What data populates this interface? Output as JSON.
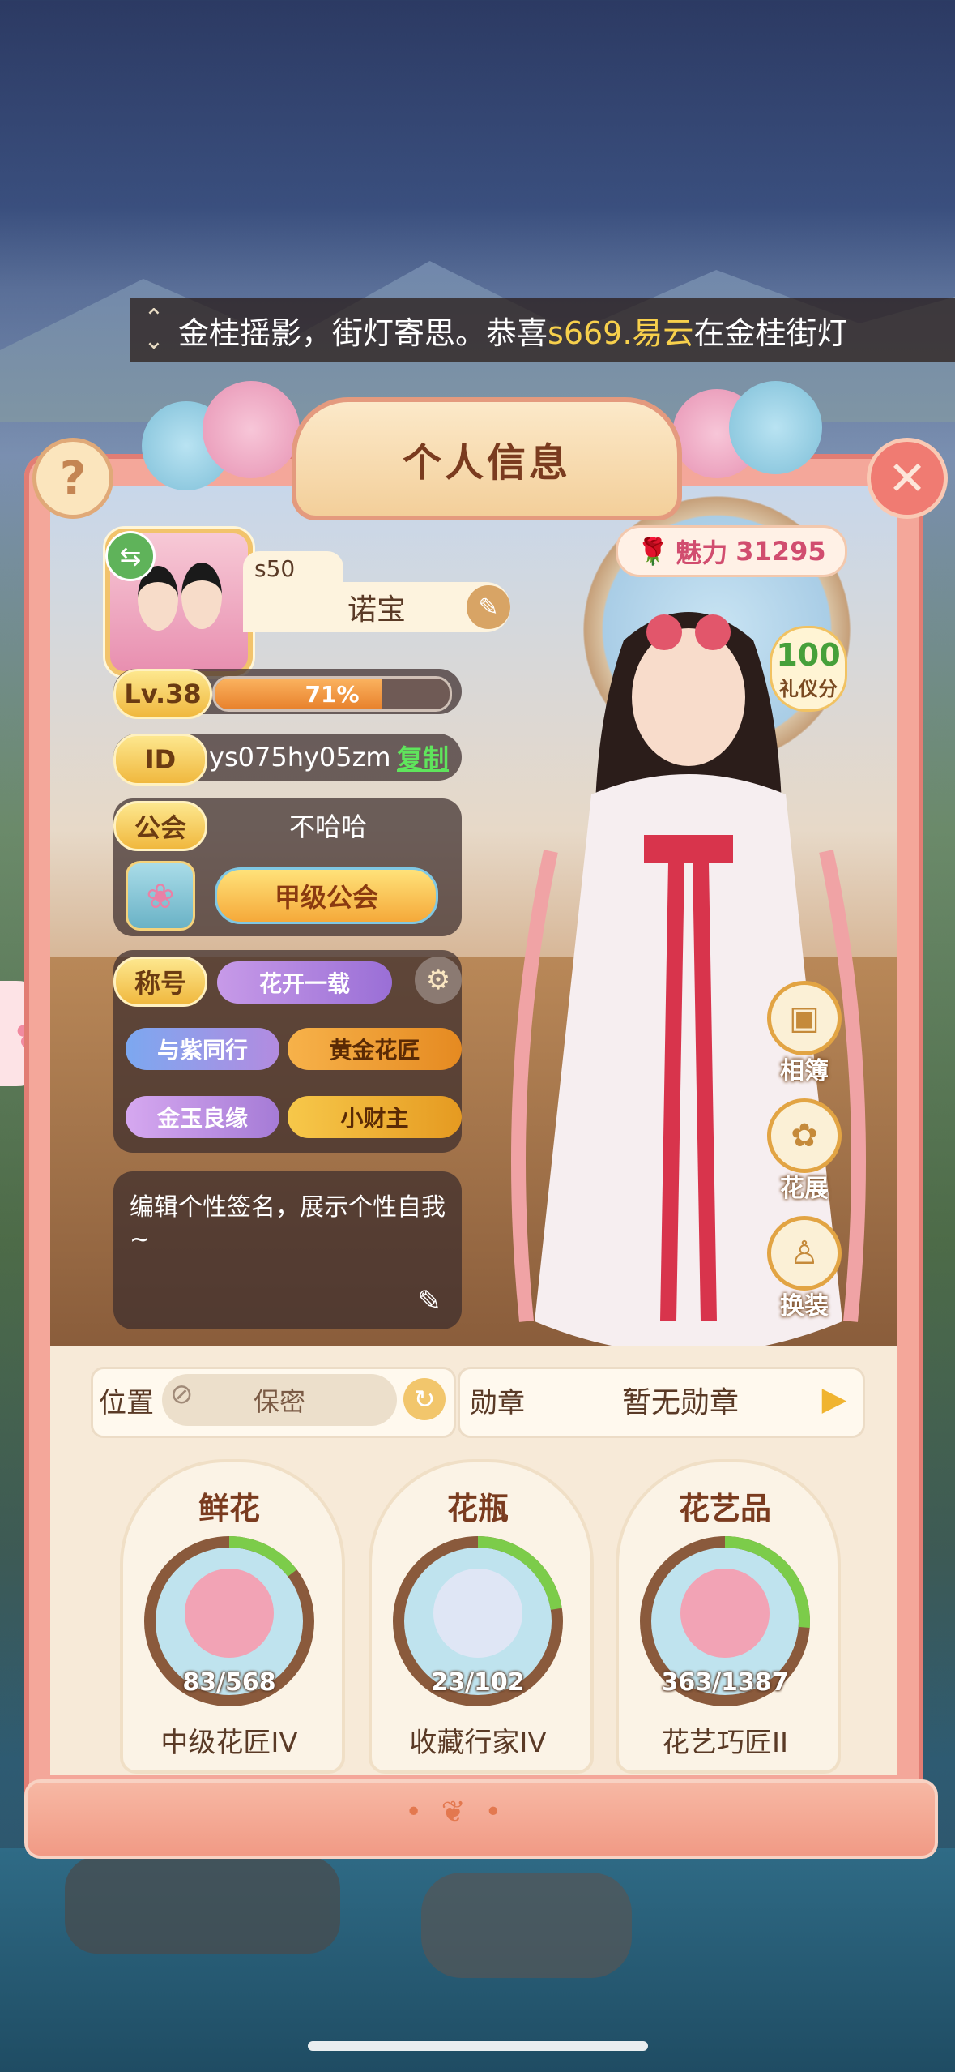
{
  "marquee": {
    "text_before": "金桂摇影，街灯寄思。恭喜 ",
    "highlight": "s669.易云",
    "text_after": " 在金桂街灯"
  },
  "panel": {
    "title": "个人信息"
  },
  "profile": {
    "server": "s50",
    "name": "诺宝",
    "level_label": "Lv.38",
    "level_progress": 0.71,
    "level_progress_text": "71%",
    "id_label": "ID",
    "id_value": "ys075hy05zm",
    "copy_label": "复制",
    "guild_label": "公会",
    "guild_name": "不哈哈",
    "guild_rank": "甲级公会",
    "title_label": "称号",
    "titles": [
      "花开一载",
      "与紫同行",
      "黄金花匠",
      "金玉良缘",
      "小财主"
    ],
    "signature": "编辑个性签名，展示个性自我~"
  },
  "charm": {
    "label": "魅力",
    "value": "31295"
  },
  "etiquette": {
    "value": "100",
    "label": "礼仪分"
  },
  "side_buttons": [
    "相簿",
    "花展",
    "换装"
  ],
  "location": {
    "label": "位置",
    "value": "保密"
  },
  "medal": {
    "label": "勋章",
    "value": "暂无勋章"
  },
  "collections": [
    {
      "title": "鲜花",
      "count": "83/568",
      "rank": "中级花匠IV",
      "progress": 0.146
    },
    {
      "title": "花瓶",
      "count": "23/102",
      "rank": "收藏行家IV",
      "progress": 0.225
    },
    {
      "title": "花艺品",
      "count": "363/1387",
      "rank": "花艺巧匠II",
      "progress": 0.262
    }
  ],
  "colors": {
    "accent": "#f4a79a",
    "gold": "#f0b83e",
    "green": "#5fe55c",
    "charm": "#d14d6f"
  }
}
